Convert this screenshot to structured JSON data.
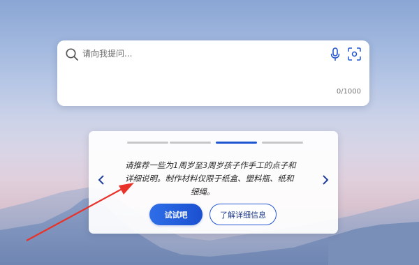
{
  "search": {
    "placeholder": "请向我提问...",
    "char_count": "0/1000"
  },
  "icons": {
    "search": "search-icon",
    "mic": "mic-icon",
    "scan": "scan-icon",
    "prev": "chevron-left-icon",
    "next": "chevron-right-icon"
  },
  "carousel": {
    "total": 4,
    "active_index": 2,
    "line1": "请推荐一些为1周岁至3周岁孩子作手工的点子和",
    "line2": "详细说明。制作材料仅限于纸盒、塑料瓶、纸和",
    "line3": "细绳。",
    "try_label": "试试吧",
    "more_label": "了解详细信息"
  },
  "colors": {
    "accent": "#1e56d2",
    "annotation_arrow": "#e8322a"
  }
}
